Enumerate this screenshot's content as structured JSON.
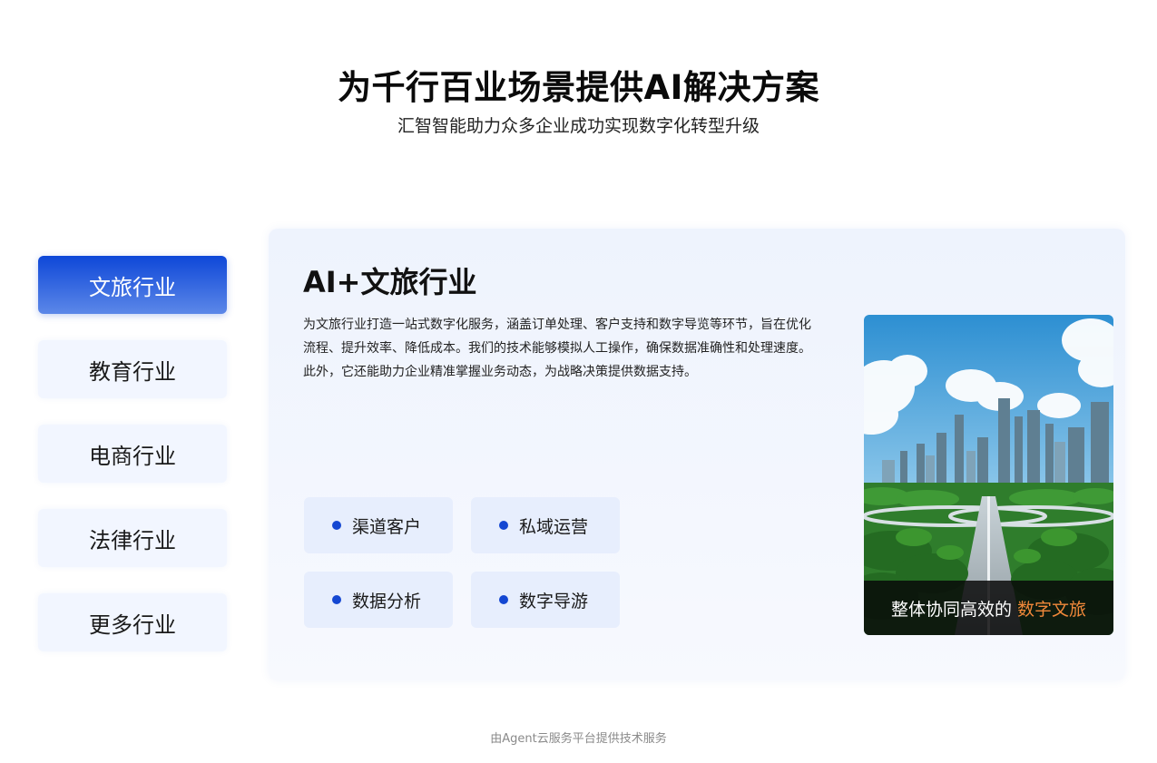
{
  "hero": {
    "title": "为千行百业场景提供AI解决方案",
    "subtitle": "汇智智能助力众多企业成功实现数字化转型升级"
  },
  "nav": {
    "items": [
      {
        "label": "文旅行业",
        "active": true
      },
      {
        "label": "教育行业",
        "active": false
      },
      {
        "label": "电商行业",
        "active": false
      },
      {
        "label": "法律行业",
        "active": false
      },
      {
        "label": "更多行业",
        "active": false
      }
    ]
  },
  "card": {
    "title": "AI+文旅行业",
    "description": "为文旅行业打造一站式数字化服务，涵盖订单处理、客户支持和数字导览等环节，旨在优化流程、提升效率、降低成本。我们的技术能够模拟人工操作，确保数据准确性和处理速度。此外，它还能助力企业精准掌握业务动态，为战略决策提供数据支持。",
    "tags": [
      "渠道客户",
      "私域运营",
      "数据分析",
      "数字导游"
    ],
    "image": {
      "subject": "city-skyline-park-photo",
      "caption_prefix": "整体协同高效的",
      "caption_highlight": "数字文旅"
    }
  },
  "footer": {
    "text": "由Agent云服务平台提供技术服务"
  },
  "colors": {
    "brand_blue": "#0e47d8",
    "tag_dot": "#1447d2",
    "highlight_orange": "#f0883a"
  }
}
